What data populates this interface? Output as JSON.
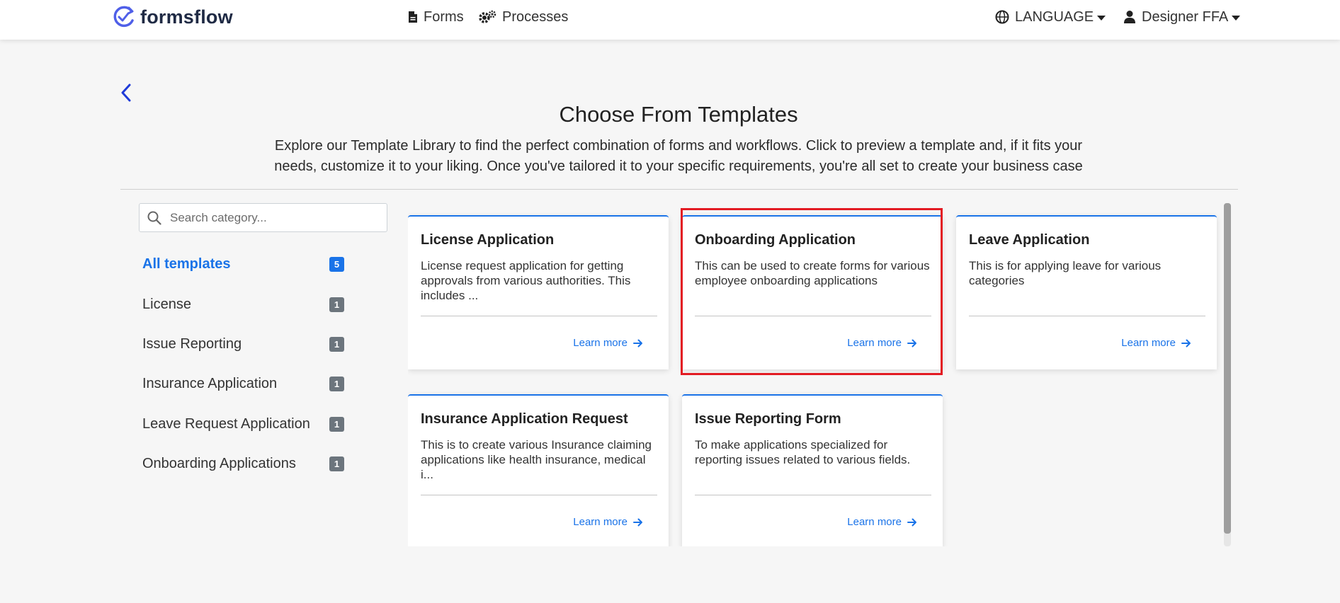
{
  "navbar": {
    "brand": "formsflow",
    "links": {
      "forms": "Forms",
      "processes": "Processes"
    },
    "language": "LANGUAGE",
    "user": "Designer FFA"
  },
  "header": {
    "title": "Choose From Templates",
    "description": "Explore our Template Library to find the perfect combination of forms and workflows. Click to preview a template and, if it fits your needs, customize it to your liking. Once you've tailored it to your specific requirements, you're all set to create your business case"
  },
  "sidebar": {
    "search_placeholder": "Search category...",
    "categories": [
      {
        "label": "All templates",
        "count": "5",
        "active": true
      },
      {
        "label": "License",
        "count": "1"
      },
      {
        "label": "Issue Reporting",
        "count": "1"
      },
      {
        "label": "Insurance Application",
        "count": "1"
      },
      {
        "label": "Leave Request Application",
        "count": "1"
      },
      {
        "label": "Onboarding Applications",
        "count": "1"
      }
    ]
  },
  "templates": [
    {
      "title": "License Application",
      "description": "License request application for getting approvals from various authorities. This includes ...",
      "link": "Learn more"
    },
    {
      "title": "Onboarding Application",
      "description": "This can be used to create forms for various employee onboarding applications",
      "link": "Learn more",
      "highlighted": true
    },
    {
      "title": "Leave Application",
      "description": "This is for applying leave for various categories",
      "link": "Learn more"
    },
    {
      "title": "Insurance Application Request",
      "description": "This is to create various Insurance claiming applications like health insurance, medical i...",
      "link": "Learn more"
    },
    {
      "title": "Issue Reporting Form",
      "description": "To make applications specialized for reporting issues related to various fields.",
      "link": "Learn more"
    }
  ],
  "colors": {
    "accent": "#1a73e8",
    "highlight": "#e31b23",
    "badge": "#6c757d",
    "background": "#f6f6f6"
  },
  "icons": {
    "brand": "formsflow-logo-icon",
    "forms": "document-icon",
    "processes": "gears-icon",
    "language": "globe-icon",
    "user": "user-icon",
    "back": "chevron-left-icon",
    "search": "search-icon",
    "learn_more": "arrow-right-icon"
  }
}
